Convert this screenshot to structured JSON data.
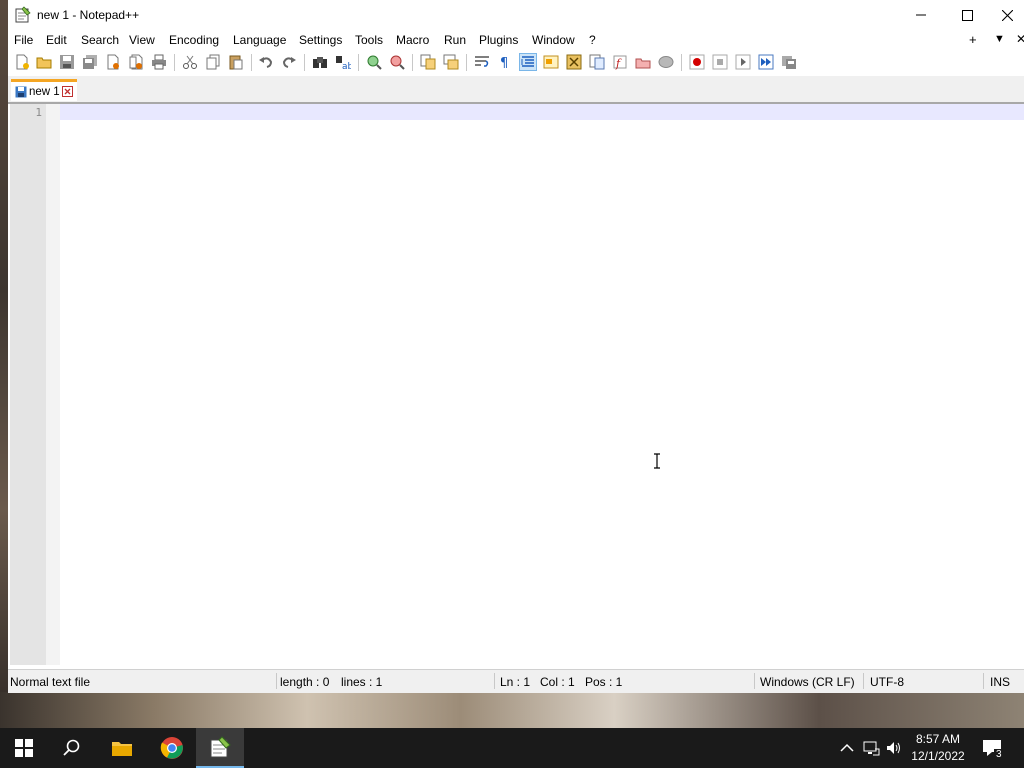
{
  "window": {
    "title": "new 1 - Notepad++"
  },
  "menu": {
    "items": [
      "File",
      "Edit",
      "Search",
      "View",
      "Encoding",
      "Language",
      "Settings",
      "Tools",
      "Macro",
      "Run",
      "Plugins",
      "Window",
      "?"
    ],
    "right_plus": "+",
    "right_down": "▼",
    "right_close": "✕"
  },
  "toolbar": {
    "icons": [
      "new-file-icon",
      "open-file-icon",
      "save-icon",
      "save-all-icon",
      "close-icon",
      "close-all-icon",
      "print-icon",
      "cut-icon",
      "copy-icon",
      "paste-icon",
      "undo-icon",
      "redo-icon",
      "find-icon",
      "replace-icon",
      "zoom-in-icon",
      "zoom-out-icon",
      "sync-vertical-icon",
      "sync-horizontal-icon",
      "word-wrap-icon",
      "show-all-chars-icon",
      "indent-guide-icon",
      "udl-icon",
      "doc-map-icon",
      "function-list-icon",
      "folder-workspace-icon",
      "monitoring-icon",
      "record-macro-icon",
      "stop-record-icon",
      "play-macro-icon",
      "run-macro-multiple-icon",
      "save-macro-icon"
    ]
  },
  "tabs": [
    {
      "label": "new 1",
      "active": true
    }
  ],
  "editor": {
    "line_numbers": [
      "1"
    ],
    "content": "",
    "current_line_color": "#e8e8ff"
  },
  "status": {
    "file_type": "Normal text file",
    "length": "length : 0",
    "lines": "lines : 1",
    "ln": "Ln : 1",
    "col": "Col : 1",
    "pos": "Pos : 1",
    "eol": "Windows (CR LF)",
    "encoding": "UTF-8",
    "mode": "INS"
  },
  "taskbar": {
    "apps": [
      "start-icon",
      "search-icon",
      "file-explorer-icon",
      "chrome-icon",
      "notepadpp-icon"
    ],
    "clock_time": "8:57 AM",
    "clock_date": "12/1/2022",
    "notification_count": "3",
    "accent": "#76b9ed"
  },
  "colors": {
    "tab_accent": "#f5a623",
    "record_red": "#d40000"
  }
}
